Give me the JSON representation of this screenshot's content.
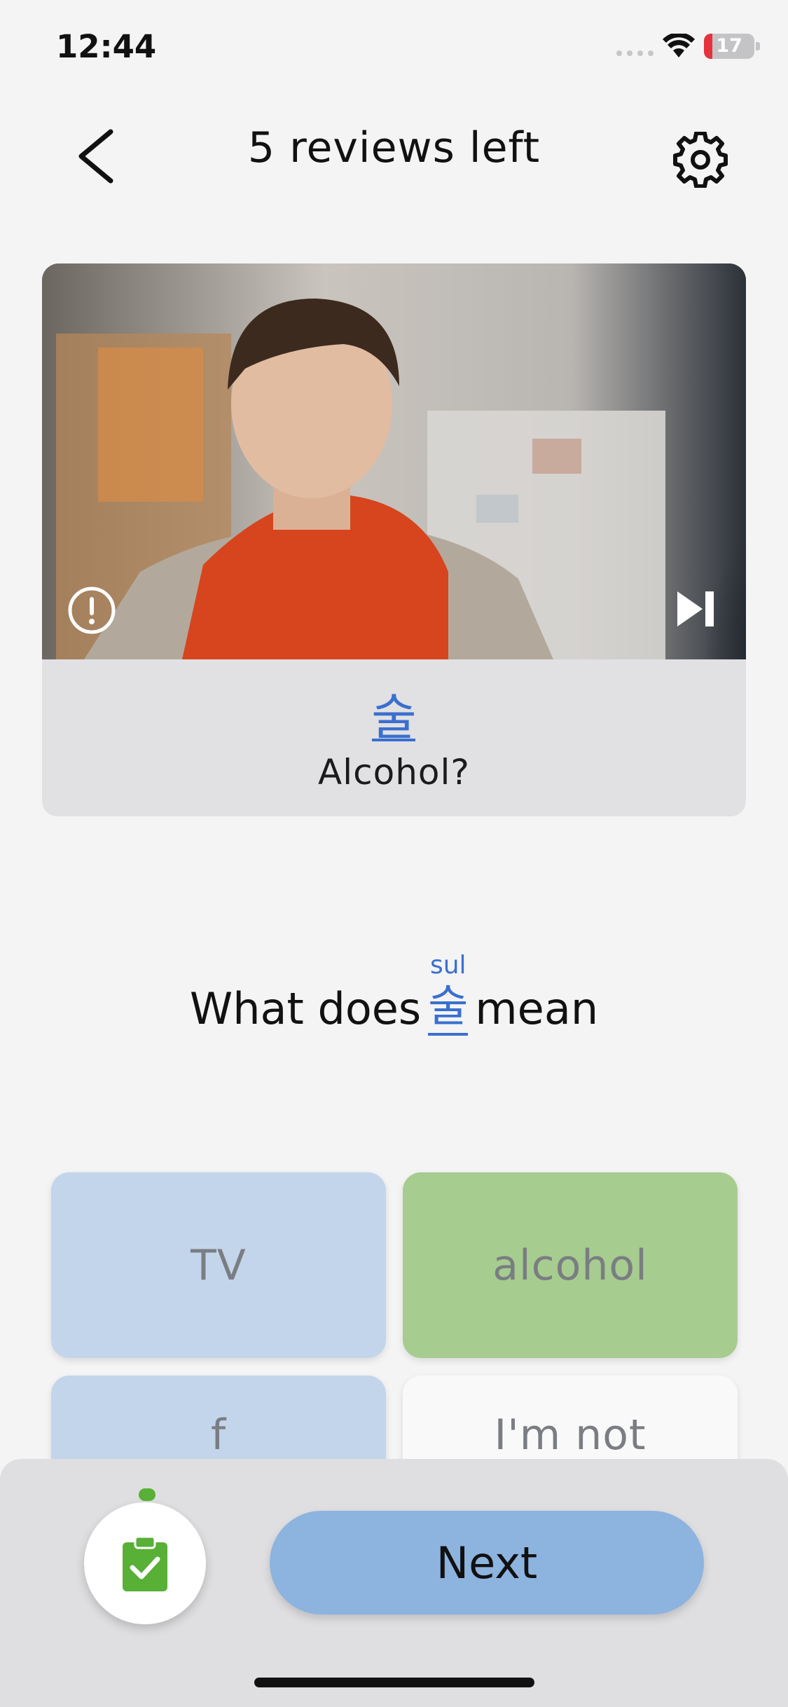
{
  "status_bar": {
    "time": "12:44",
    "battery": "17",
    "battery_level": 0.17
  },
  "header": {
    "title": "5 reviews left",
    "back_icon": "chevron-left-icon",
    "settings_icon": "gear-icon"
  },
  "video": {
    "alert_icon": "alert-circle-icon",
    "skip_icon": "skip-forward-icon"
  },
  "subtitle": {
    "word": "술",
    "translation": "Alcohol?"
  },
  "question": {
    "prefix": "What does",
    "word": "술",
    "romanization": "sul",
    "suffix": "mean"
  },
  "options": [
    {
      "label": "TV",
      "state": "neutral"
    },
    {
      "label": "alcohol",
      "state": "correct"
    },
    {
      "label": "f",
      "state": "neutral"
    },
    {
      "label": "I'm not",
      "state": "unselected"
    }
  ],
  "footer": {
    "next_label": "Next",
    "clipboard_icon": "clipboard-check-icon"
  },
  "colors": {
    "accent": "#3a6fd0",
    "correct": "#a6cc8f",
    "option": "#c3d5ea",
    "next": "#8db3df",
    "indicator": "#58b036"
  }
}
